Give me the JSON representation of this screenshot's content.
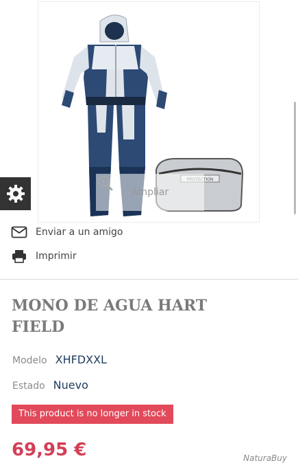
{
  "gallery": {
    "zoom_label": "Ampliar",
    "bag_label": "PROTECTION"
  },
  "actions": {
    "send_to_friend": "Enviar a un amigo",
    "print": "Imprimir"
  },
  "product": {
    "title": "MONO DE AGUA HART FIELD",
    "model_label": "Modelo",
    "model_value": "XHFDXXL",
    "condition_label": "Estado",
    "condition_value": "Nuevo",
    "stock_message": "This product is no longer in stock",
    "price": "69,95 €"
  },
  "watermark": "NaturaBuy",
  "colors": {
    "price": "#d33f57",
    "stock_badge": "#e2495a",
    "spec_value": "#1e3a5f",
    "settings_tab": "#333333"
  },
  "icons": {
    "settings": "gear-icon",
    "zoom": "magnifier-icon",
    "email": "envelope-icon",
    "print": "printer-icon"
  }
}
